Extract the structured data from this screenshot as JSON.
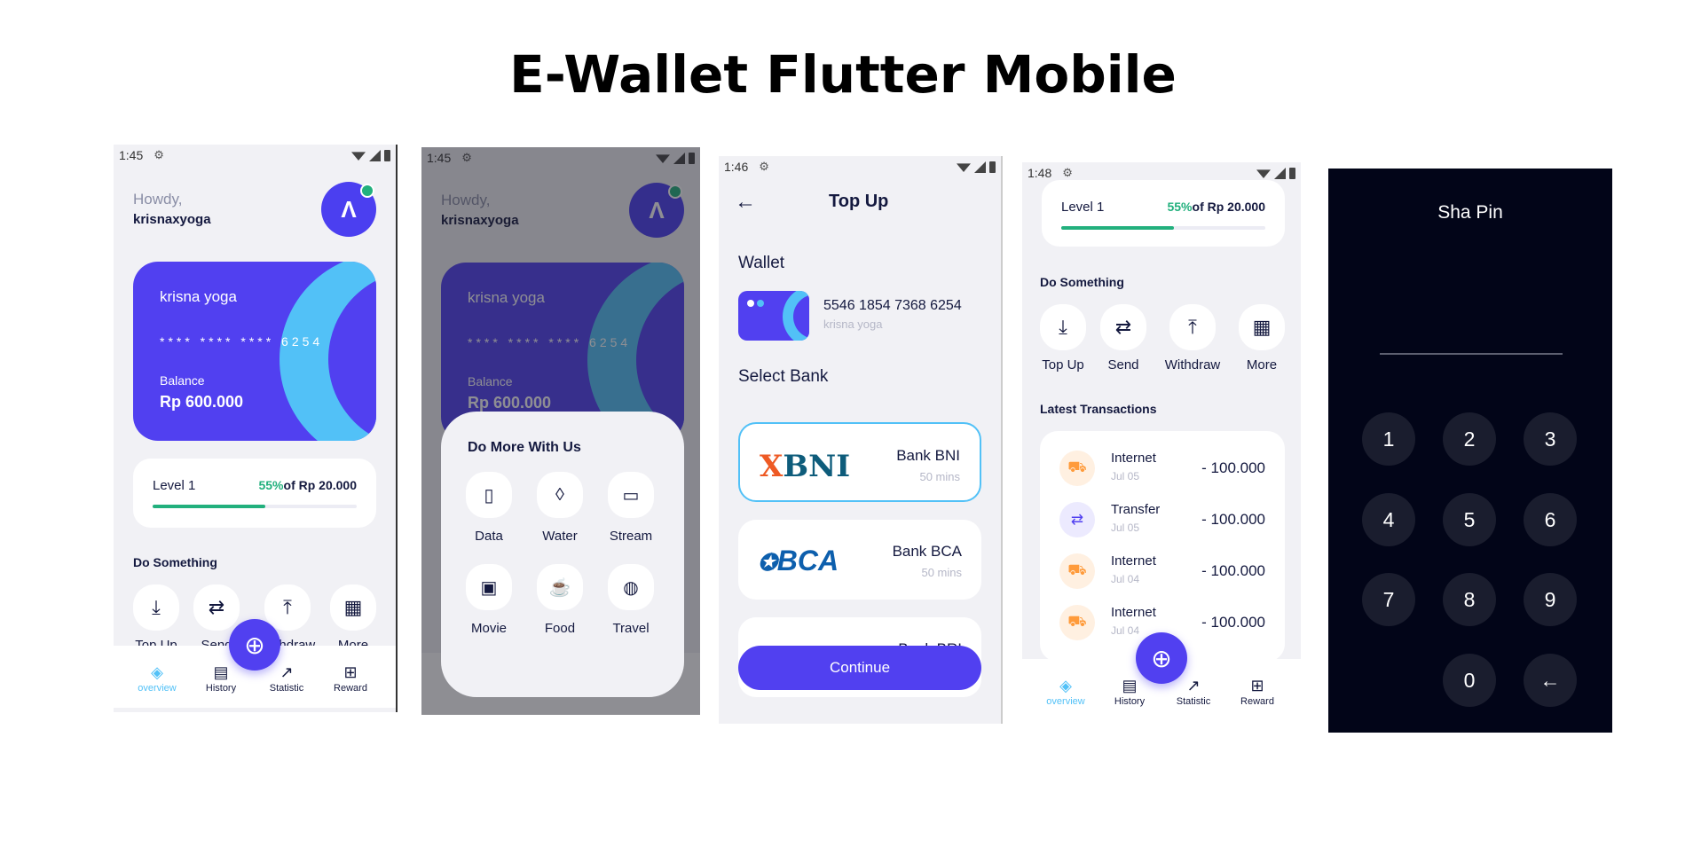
{
  "title": "E-Wallet Flutter Mobile",
  "colors": {
    "primary": "#5140f0",
    "accent": "#52c1f7",
    "success": "#22b07d",
    "pin_bg": "#020518"
  },
  "screen1": {
    "time": "1:45",
    "greeting": "Howdy,",
    "username": "krisnaxyoga",
    "card": {
      "name": "krisna yoga",
      "number": "**** **** **** 6254",
      "balance_label": "Balance",
      "balance": "Rp 600.000"
    },
    "level": {
      "label": "Level 1",
      "percent": "55%",
      "of": "of Rp 20.000",
      "progress": 0.55
    },
    "section": "Do Something",
    "actions": [
      {
        "label": "Top Up",
        "icon": "download-icon"
      },
      {
        "label": "Send",
        "icon": "transfer-icon"
      },
      {
        "label": "Withdraw",
        "icon": "upload-icon"
      },
      {
        "label": "More",
        "icon": "grid-icon"
      }
    ],
    "nav": [
      {
        "label": "overview",
        "icon": "layers-icon"
      },
      {
        "label": "History",
        "icon": "document-icon"
      },
      {
        "label": "Statistic",
        "icon": "trending-icon"
      },
      {
        "label": "Reward",
        "icon": "gift-icon"
      }
    ]
  },
  "screen2": {
    "time": "1:45",
    "greeting": "Howdy,",
    "username": "krisnaxyoga",
    "card": {
      "name": "krisna yoga",
      "number": "**** **** **** 6254",
      "balance_label": "Balance",
      "balance": "Rp 600.000"
    },
    "sheet_title": "Do More With Us",
    "items": [
      {
        "label": "Data",
        "icon": "phone-icon"
      },
      {
        "label": "Water",
        "icon": "drop-icon"
      },
      {
        "label": "Stream",
        "icon": "twitch-icon"
      },
      {
        "label": "Movie",
        "icon": "tv-icon"
      },
      {
        "label": "Food",
        "icon": "coffee-icon"
      },
      {
        "label": "Travel",
        "icon": "globe-icon"
      }
    ]
  },
  "screen3": {
    "time": "1:46",
    "header": "Top Up",
    "wallet_label": "Wallet",
    "wallet_number": "5546 1854 7368 6254",
    "wallet_name": "krisna yoga",
    "select_bank": "Select Bank",
    "banks": [
      {
        "logo": "BNI",
        "name": "Bank BNI",
        "time": "50 mins"
      },
      {
        "logo": "BCA",
        "name": "Bank BCA",
        "time": "50 mins"
      },
      {
        "name": "Bank BRI"
      }
    ],
    "continue": "Continue"
  },
  "screen4": {
    "time": "1:48",
    "level": {
      "label": "Level 1",
      "percent": "55%",
      "of": "of Rp 20.000",
      "progress": 0.55
    },
    "section": "Do Something",
    "actions": [
      {
        "label": "Top Up"
      },
      {
        "label": "Send"
      },
      {
        "label": "Withdraw"
      },
      {
        "label": "More"
      }
    ],
    "tx_title": "Latest Transactions",
    "transactions": [
      {
        "name": "Internet",
        "date": "Jul 05",
        "amount": "- 100.000",
        "type": "cart"
      },
      {
        "name": "Transfer",
        "date": "Jul 05",
        "amount": "- 100.000",
        "type": "transfer"
      },
      {
        "name": "Internet",
        "date": "Jul 04",
        "amount": "- 100.000",
        "type": "cart"
      },
      {
        "name": "Internet",
        "date": "Jul 04",
        "amount": "- 100.000",
        "type": "cart"
      }
    ],
    "nav": [
      {
        "label": "overview"
      },
      {
        "label": "History"
      },
      {
        "label": "Statistic"
      },
      {
        "label": "Reward"
      }
    ]
  },
  "screen5": {
    "title": "Sha Pin",
    "keys": [
      "1",
      "2",
      "3",
      "4",
      "5",
      "6",
      "7",
      "8",
      "9",
      "0",
      "←"
    ]
  }
}
